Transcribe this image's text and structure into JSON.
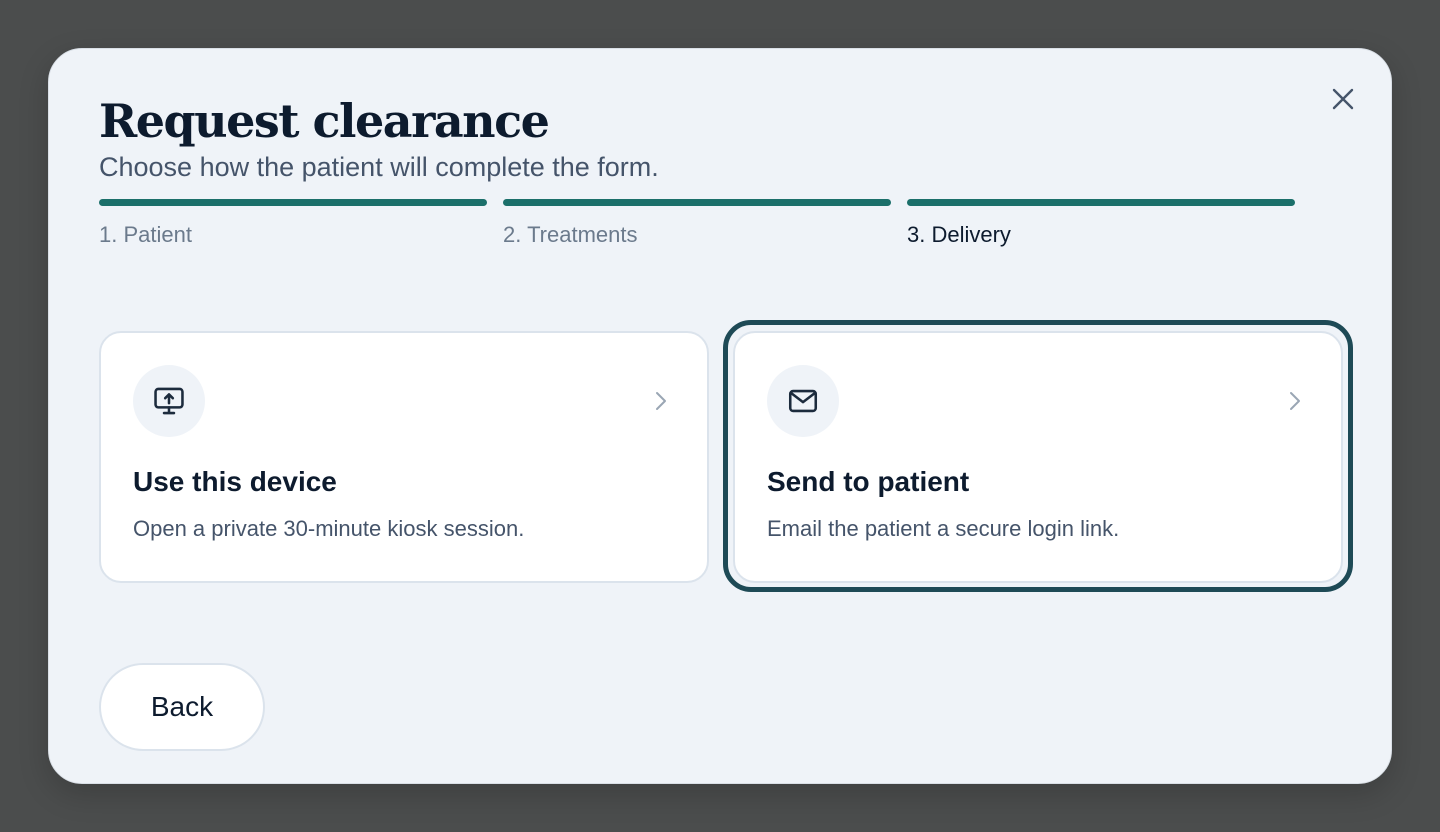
{
  "modal": {
    "title": "Request clearance",
    "subtitle": "Choose how the patient will complete the form.",
    "close_icon": "close-icon"
  },
  "steps": [
    {
      "label": "1. Patient",
      "complete": true,
      "active": false
    },
    {
      "label": "2. Treatments",
      "complete": true,
      "active": false
    },
    {
      "label": "3. Delivery",
      "complete": true,
      "active": true
    }
  ],
  "options": [
    {
      "icon": "monitor-upload-icon",
      "title": "Use this device",
      "description": "Open a private 30-minute kiosk session.",
      "selected": false
    },
    {
      "icon": "mail-icon",
      "title": "Send to patient",
      "description": "Email the patient a secure login link.",
      "selected": true
    }
  ],
  "footer": {
    "back_label": "Back"
  },
  "colors": {
    "accent": "#1b6f6a",
    "focus_ring": "#1e4a56",
    "modal_bg": "#eff3f8",
    "backdrop": "#4b4d4d",
    "text_primary": "#0d1b2e",
    "text_secondary": "#45546a"
  }
}
